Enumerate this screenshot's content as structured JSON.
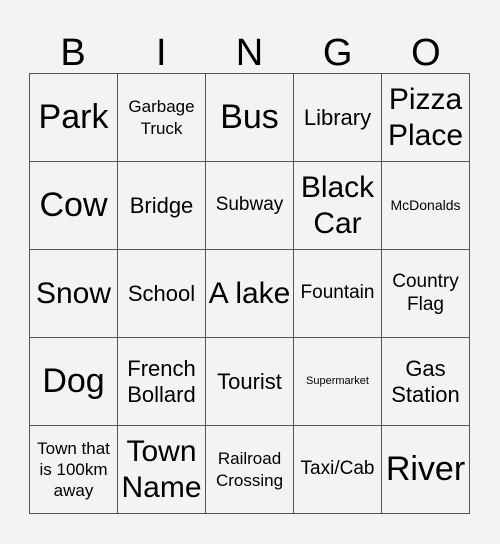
{
  "header": [
    "B",
    "I",
    "N",
    "G",
    "O"
  ],
  "cells": [
    "Park",
    "Garbage Truck",
    "Bus",
    "Library",
    "Pizza Place",
    "Cow",
    "Bridge",
    "Subway",
    "Black Car",
    "McDonalds",
    "Snow",
    "School",
    "A lake",
    "Fountain",
    "Country Flag",
    "Dog",
    "French Bollard",
    "Tourist",
    "Supermarket",
    "Gas Station",
    "Town that is 100km away",
    "Town Name",
    "Railroad Crossing",
    "Taxi/Cab",
    "River"
  ]
}
